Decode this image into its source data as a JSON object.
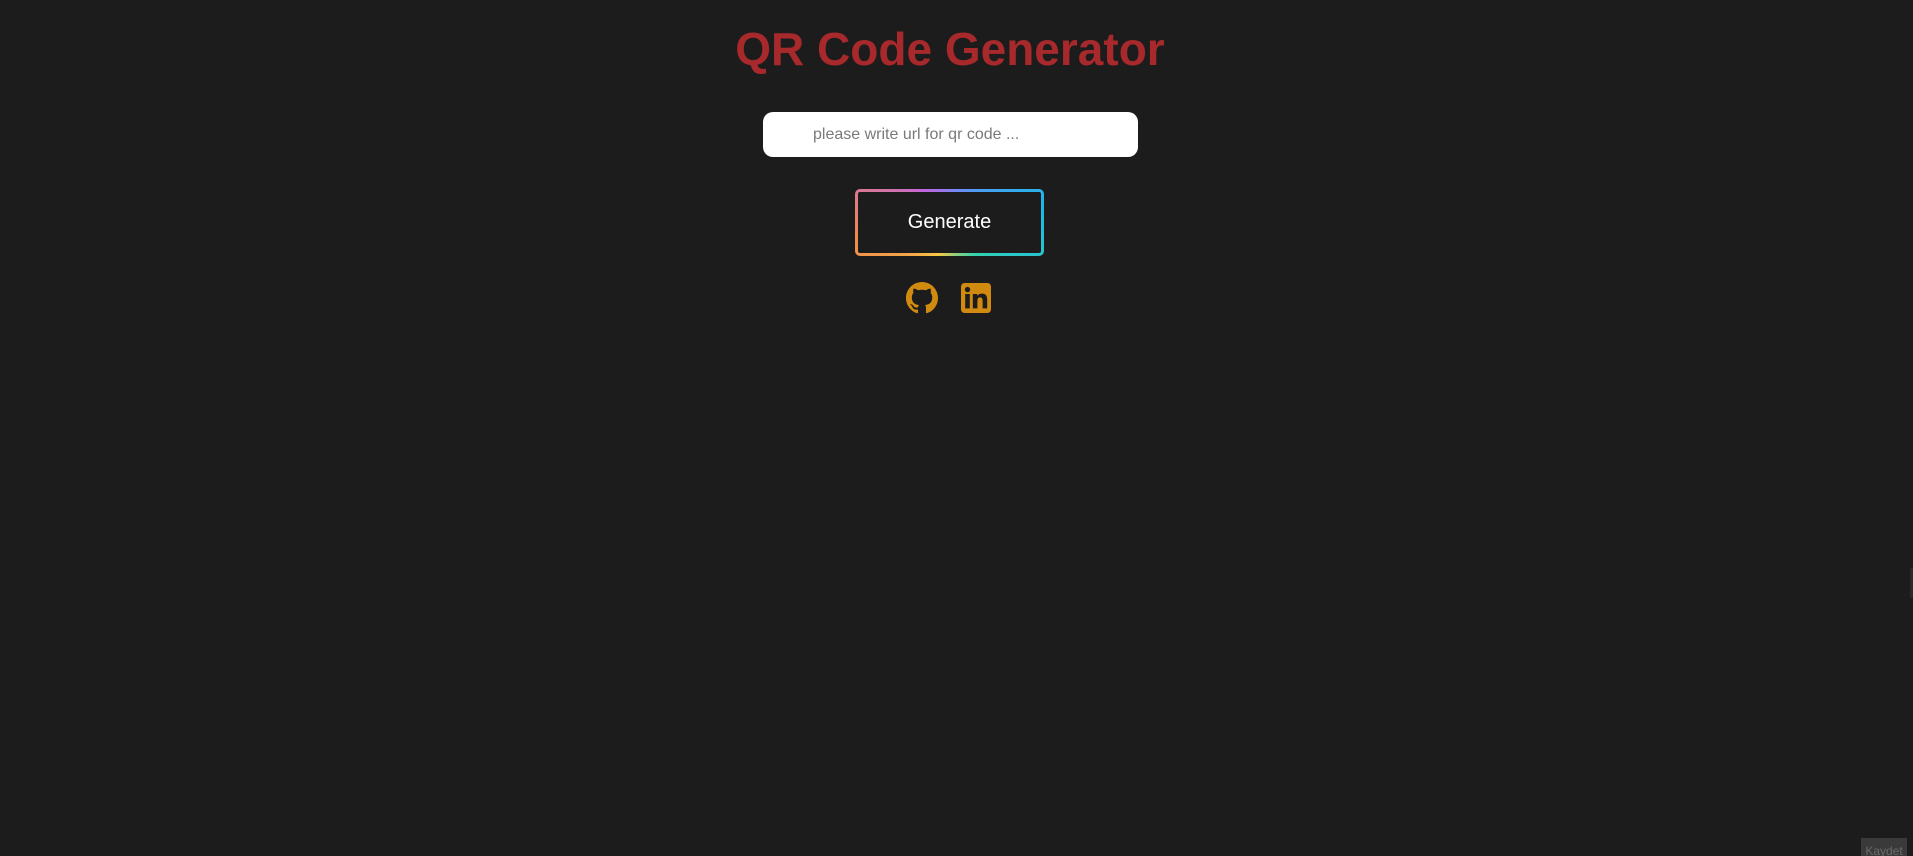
{
  "app": {
    "title": "QR Code Generator",
    "title_color": "#a8292b"
  },
  "form": {
    "url_placeholder": "please write url for qr code ...",
    "url_value": "",
    "generate_label": "Generate"
  },
  "social": {
    "links": [
      {
        "icon": "github-icon",
        "color": "#d08a10"
      },
      {
        "icon": "linkedin-icon",
        "color": "#d08a10"
      }
    ]
  },
  "corner_badge": {
    "label": "Kaydet"
  }
}
